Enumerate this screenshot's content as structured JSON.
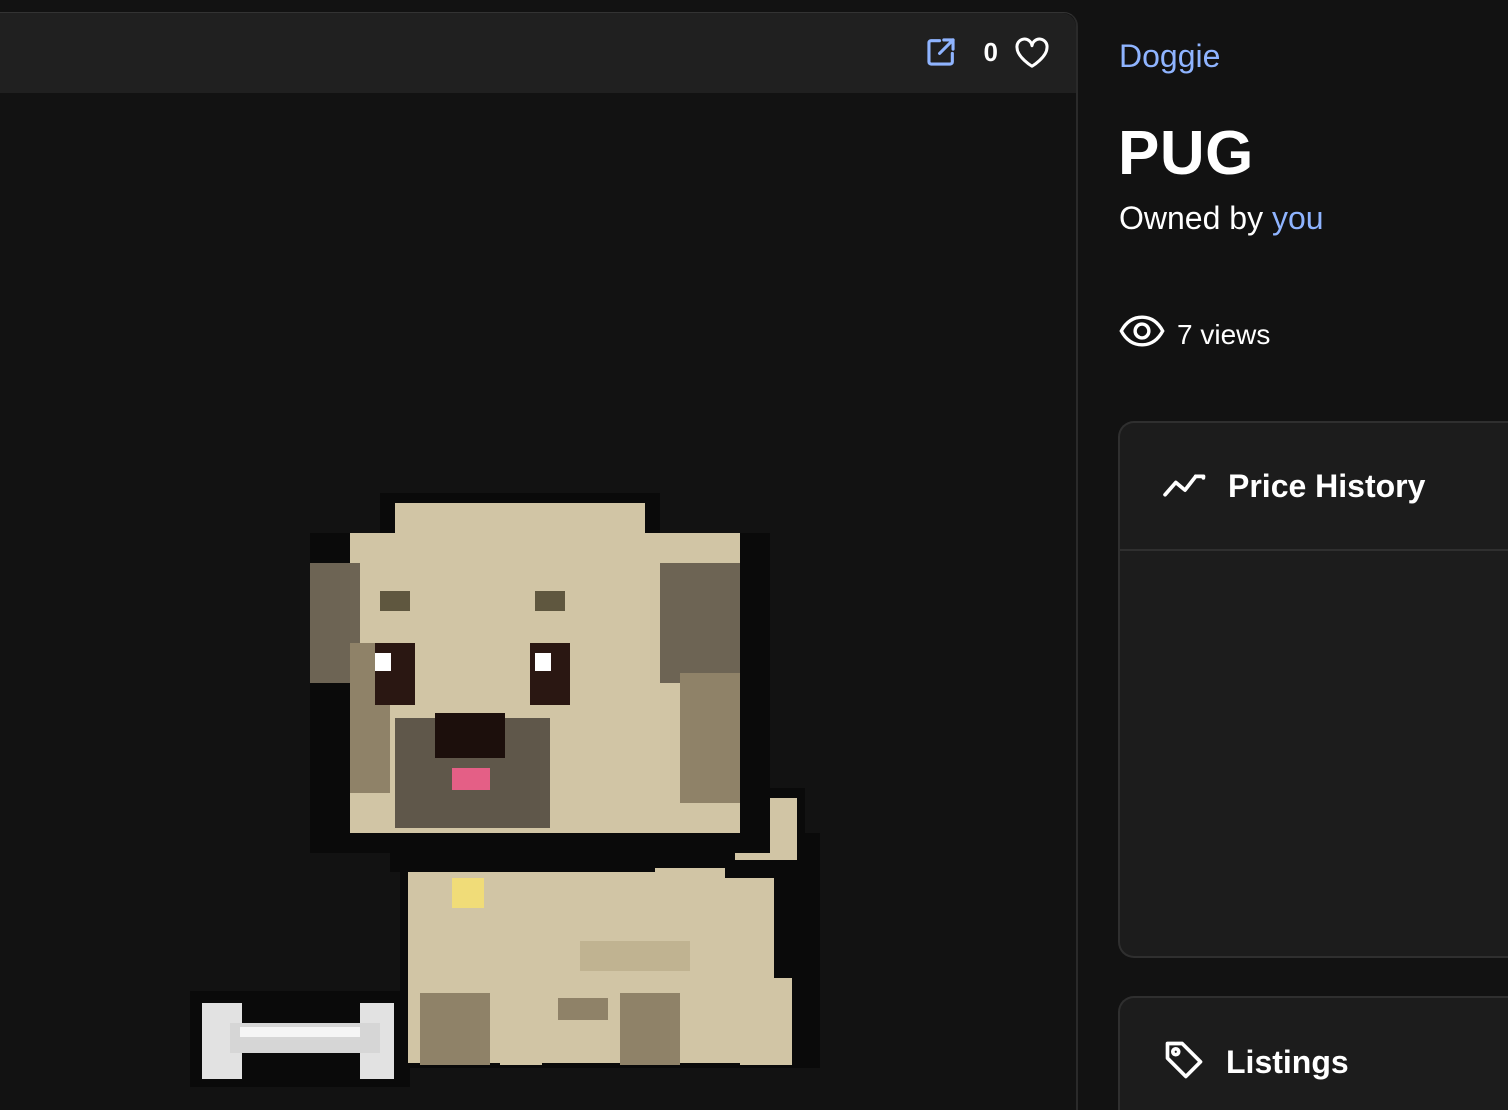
{
  "header": {
    "favorite_count": "0",
    "icons": [
      "external-link-icon",
      "heart-icon"
    ]
  },
  "item": {
    "collection": "Doggie",
    "title": "PUG",
    "owner_prefix": "Owned by",
    "owner": "you",
    "views_text": "7 views"
  },
  "panels": {
    "price_history": {
      "title": "Price History",
      "icon": "trend-line-icon"
    },
    "listings": {
      "title": "Listings",
      "icon": "tag-icon"
    }
  },
  "colors": {
    "link": "#8fb4ff",
    "background": "#121212",
    "header": "#202020",
    "panel": "#1c1c1c"
  }
}
